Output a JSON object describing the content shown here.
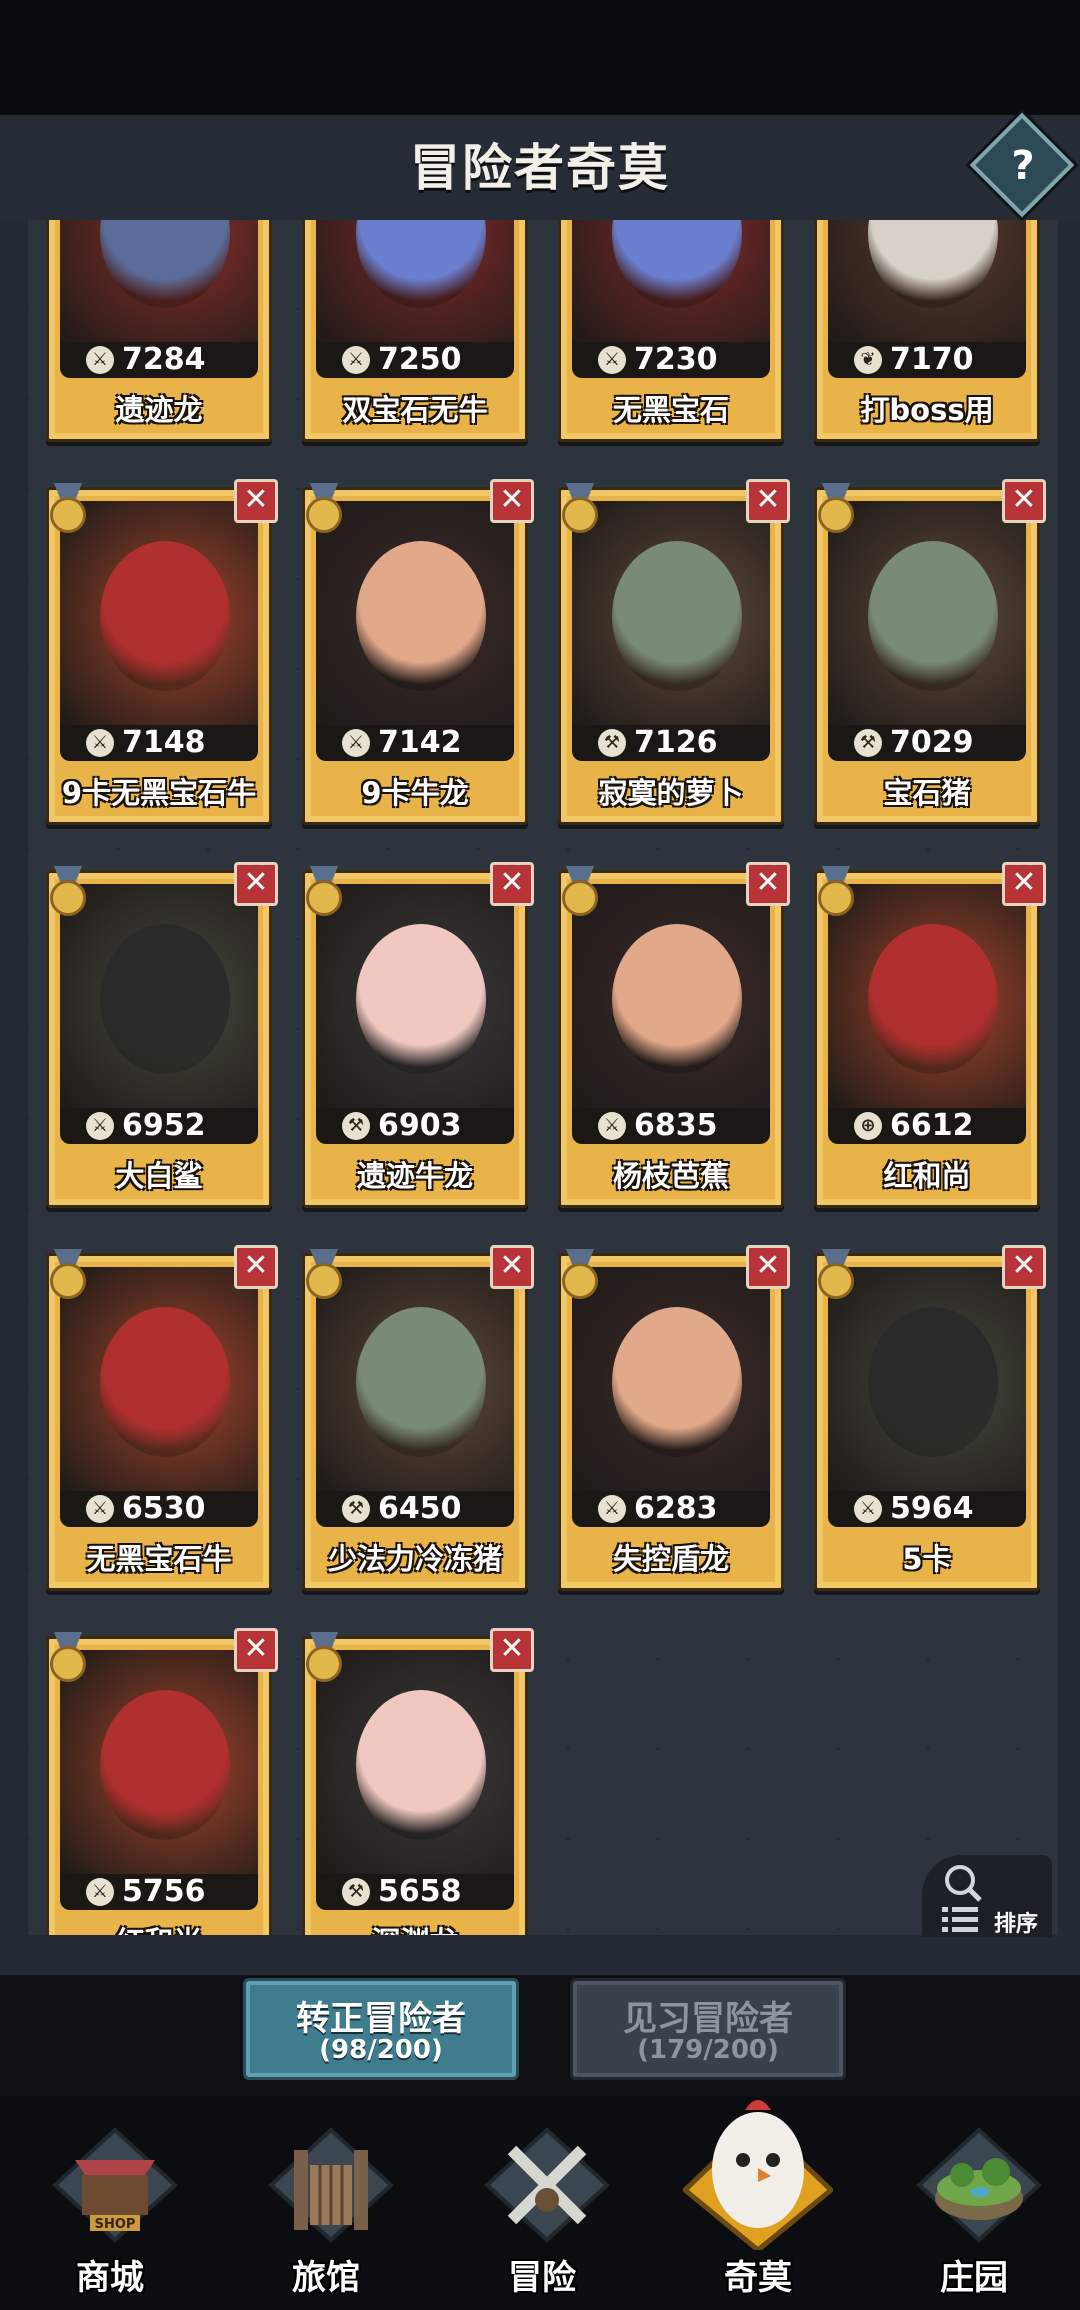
{
  "header": {
    "title": "冒险者奇莫",
    "help_label": "?"
  },
  "cards": [
    {
      "name": "遗迹龙",
      "power": "7284",
      "icon": "sword-icon",
      "bg": "#8b2f2a",
      "char": "#5b6c9a",
      "partial": true
    },
    {
      "name": "双宝石无牛",
      "power": "7250",
      "icon": "sword-icon",
      "bg": "#7d2a2a",
      "char": "#6a7fd0",
      "partial": true
    },
    {
      "name": "无黑宝石",
      "power": "7230",
      "icon": "sword-icon",
      "bg": "#7d2a2a",
      "char": "#6a7fd0",
      "partial": true
    },
    {
      "name": "打boss用",
      "power": "7170",
      "icon": "leaf-icon",
      "bg": "#5a3a2e",
      "char": "#d8d1c9",
      "partial": true
    },
    {
      "name": "9卡无黑宝石牛",
      "power": "7148",
      "icon": "sword-icon",
      "bg": "#a3452a",
      "char": "#b02f2f"
    },
    {
      "name": "9卡牛龙",
      "power": "7142",
      "icon": "sword-icon",
      "bg": "#3a2b28",
      "char": "#e2a88a"
    },
    {
      "name": "寂寞的萝卜",
      "power": "7126",
      "icon": "hammer-icon",
      "bg": "#5e4a3c",
      "char": "#7a8a78"
    },
    {
      "name": "宝石猪",
      "power": "7029",
      "icon": "hammer-icon",
      "bg": "#5e4a3c",
      "char": "#7a8a78"
    },
    {
      "name": "大白鲨",
      "power": "6952",
      "icon": "sword-icon",
      "bg": "#454a3e",
      "char": "#2a2a28"
    },
    {
      "name": "遗迹牛龙",
      "power": "6903",
      "icon": "hammer-icon",
      "bg": "#3b3a3c",
      "char": "#f1c8c0"
    },
    {
      "name": "杨枝芭蕉",
      "power": "6835",
      "icon": "sword-icon",
      "bg": "#3a2b28",
      "char": "#e2a88a"
    },
    {
      "name": "红和尚",
      "power": "6612",
      "icon": "target-icon",
      "bg": "#a3452a",
      "char": "#b02f2f"
    },
    {
      "name": "无黑宝石牛",
      "power": "6530",
      "icon": "sword-icon",
      "bg": "#a3452a",
      "char": "#b02f2f"
    },
    {
      "name": "少法力冷冻猪",
      "power": "6450",
      "icon": "hammer-icon",
      "bg": "#5e4a3c",
      "char": "#7a8a78"
    },
    {
      "name": "失控盾龙",
      "power": "6283",
      "icon": "sword-icon",
      "bg": "#3a2b28",
      "char": "#e2a88a"
    },
    {
      "name": "5卡",
      "power": "5964",
      "icon": "sword-icon",
      "bg": "#454a3e",
      "char": "#2a2a28"
    },
    {
      "name": "红和尚",
      "power": "5756",
      "icon": "sword-icon",
      "bg": "#a3452a",
      "char": "#b02f2f"
    },
    {
      "name": "深渊龙",
      "power": "5658",
      "icon": "hammer-icon",
      "bg": "#3b3a3c",
      "char": "#f1c8c0"
    }
  ],
  "remove_label": "✕",
  "sort": {
    "label": "排序"
  },
  "tabs": [
    {
      "label": "转正冒险者",
      "count": "(98/200)",
      "active": true
    },
    {
      "label": "见习冒险者",
      "count": "(179/200)",
      "active": false
    }
  ],
  "nav": [
    {
      "label": "商城",
      "icon": "shop-icon",
      "sign": "SHOP"
    },
    {
      "label": "旅馆",
      "icon": "tavern-gate-icon"
    },
    {
      "label": "冒险",
      "icon": "crossed-swords-icon"
    },
    {
      "label": "奇莫",
      "icon": "chicken-mascot-icon",
      "active": true
    },
    {
      "label": "庄园",
      "icon": "island-manor-icon"
    }
  ]
}
